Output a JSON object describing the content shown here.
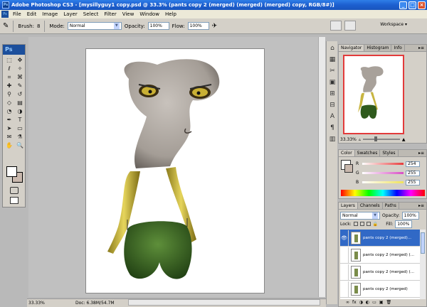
{
  "window": {
    "app_icon": "Ps",
    "title": "Adobe Photoshop CS3 - [mysillyguy1 copy.psd @ 33.3% (pants copy 2 (merged) (merged) (merged) copy, RGB/8#)]",
    "minimize": "_",
    "maximize": "□",
    "close": "×"
  },
  "menu": [
    "File",
    "Edit",
    "Image",
    "Layer",
    "Select",
    "Filter",
    "View",
    "Window",
    "Help"
  ],
  "options": {
    "brush_label": "Brush:",
    "brush_size": "8",
    "mode_label": "Mode:",
    "mode_value": "Normal",
    "opacity_label": "Opacity:",
    "opacity_value": "100%",
    "flow_label": "Flow:",
    "flow_value": "100%",
    "workspace_label": "Workspace ▾"
  },
  "toolbox": {
    "logo": "Ps",
    "tools": [
      "marquee-icon",
      "move-icon",
      "lasso-icon",
      "magic-wand-icon",
      "crop-icon",
      "slice-icon",
      "healing-icon",
      "brush-icon",
      "stamp-icon",
      "history-brush-icon",
      "eraser-icon",
      "gradient-icon",
      "blur-icon",
      "dodge-icon",
      "pen-icon",
      "type-icon",
      "path-select-icon",
      "shape-icon",
      "notes-icon",
      "eyedropper-icon",
      "hand-icon",
      "zoom-icon"
    ],
    "glyphs": [
      "⬚",
      "✥",
      "ℓ",
      "✧",
      "⌗",
      "⌘",
      "✚",
      "✎",
      "⚲",
      "↺",
      "◇",
      "▤",
      "◔",
      "◑",
      "✒",
      "T",
      "➤",
      "▭",
      "✉",
      "⚗",
      "✋",
      "🔍"
    ],
    "foreground": "#ffffff",
    "background": "#c9b8ad"
  },
  "status": {
    "zoom": "33.33%",
    "doc": "Doc: 6.38M/54.7M"
  },
  "icon_strip": [
    "⌂",
    "▦",
    "✂",
    "▣",
    "⊞",
    "⊟",
    "A",
    "¶",
    "▥"
  ],
  "navigator": {
    "tabs": [
      "Navigator",
      "Histogram",
      "Info"
    ],
    "zoom": "33.33%"
  },
  "color": {
    "tabs": [
      "Color",
      "Swatches",
      "Styles"
    ],
    "channels": [
      {
        "name": "R",
        "value": "254",
        "color": "#e83c3c"
      },
      {
        "name": "G",
        "value": "255",
        "color": "#d84fc6"
      },
      {
        "name": "B",
        "value": "255",
        "color": "#f0e35a"
      }
    ]
  },
  "layers": {
    "tabs": [
      "Layers",
      "Channels",
      "Paths"
    ],
    "blend_mode": "Normal",
    "opacity_label": "Opacity:",
    "opacity_value": "100%",
    "lock_label": "Lock:",
    "fill_label": "Fill:",
    "fill_value": "100%",
    "items": [
      {
        "name": "pants copy 2 (merged)...",
        "visible": true,
        "selected": true
      },
      {
        "name": "pants copy 2 (merged) (...",
        "visible": false,
        "selected": false
      },
      {
        "name": "pants copy 2 (merged) (...",
        "visible": false,
        "selected": false
      },
      {
        "name": "pants copy 2 (merged)",
        "visible": false,
        "selected": false
      }
    ],
    "footer_icons": [
      "∞",
      "fx",
      "◑",
      "◐",
      "▭",
      "▣",
      "🗑"
    ]
  }
}
